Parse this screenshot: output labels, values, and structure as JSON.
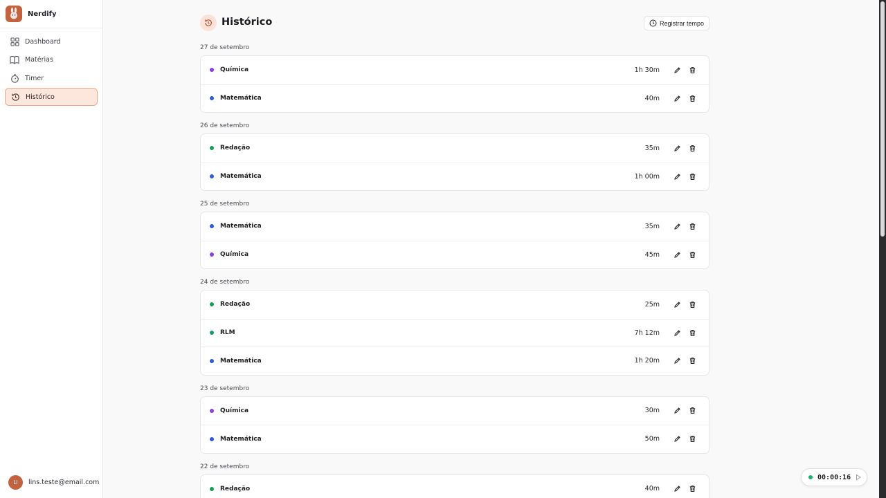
{
  "app": {
    "name": "Nerdify"
  },
  "sidebar": {
    "items": [
      {
        "label": "Dashboard",
        "icon": "grid-icon"
      },
      {
        "label": "Matérias",
        "icon": "book-icon"
      },
      {
        "label": "Timer",
        "icon": "timer-icon"
      },
      {
        "label": "Histórico",
        "icon": "history-icon",
        "active": true
      }
    ]
  },
  "user": {
    "initials": "LI",
    "email": "lins.teste@email.com"
  },
  "header": {
    "title": "Histórico",
    "register_label": "Registrar tempo"
  },
  "colors": {
    "accent": "#c4623f",
    "accent_light": "#fde6db",
    "Química": "#8b3fe0",
    "Matemática": "#2f5bd9",
    "Redação": "#179e57",
    "RLM": "#169a73",
    "timer_running": "#17b26a"
  },
  "groups": [
    {
      "date": "27 de setembro",
      "entries": [
        {
          "subject": "Química",
          "duration": "1h 30m"
        },
        {
          "subject": "Matemática",
          "duration": "40m"
        }
      ]
    },
    {
      "date": "26 de setembro",
      "entries": [
        {
          "subject": "Redação",
          "duration": "35m"
        },
        {
          "subject": "Matemática",
          "duration": "1h 00m"
        }
      ]
    },
    {
      "date": "25 de setembro",
      "entries": [
        {
          "subject": "Matemática",
          "duration": "35m"
        },
        {
          "subject": "Química",
          "duration": "45m"
        }
      ]
    },
    {
      "date": "24 de setembro",
      "entries": [
        {
          "subject": "Redação",
          "duration": "25m"
        },
        {
          "subject": "RLM",
          "duration": "7h 12m"
        },
        {
          "subject": "Matemática",
          "duration": "1h 20m"
        }
      ]
    },
    {
      "date": "23 de setembro",
      "entries": [
        {
          "subject": "Química",
          "duration": "30m"
        },
        {
          "subject": "Matemática",
          "duration": "50m"
        }
      ]
    },
    {
      "date": "22 de setembro",
      "entries": [
        {
          "subject": "Redação",
          "duration": "40m"
        }
      ]
    }
  ],
  "timer": {
    "time": "00:00:16",
    "status": "running"
  }
}
